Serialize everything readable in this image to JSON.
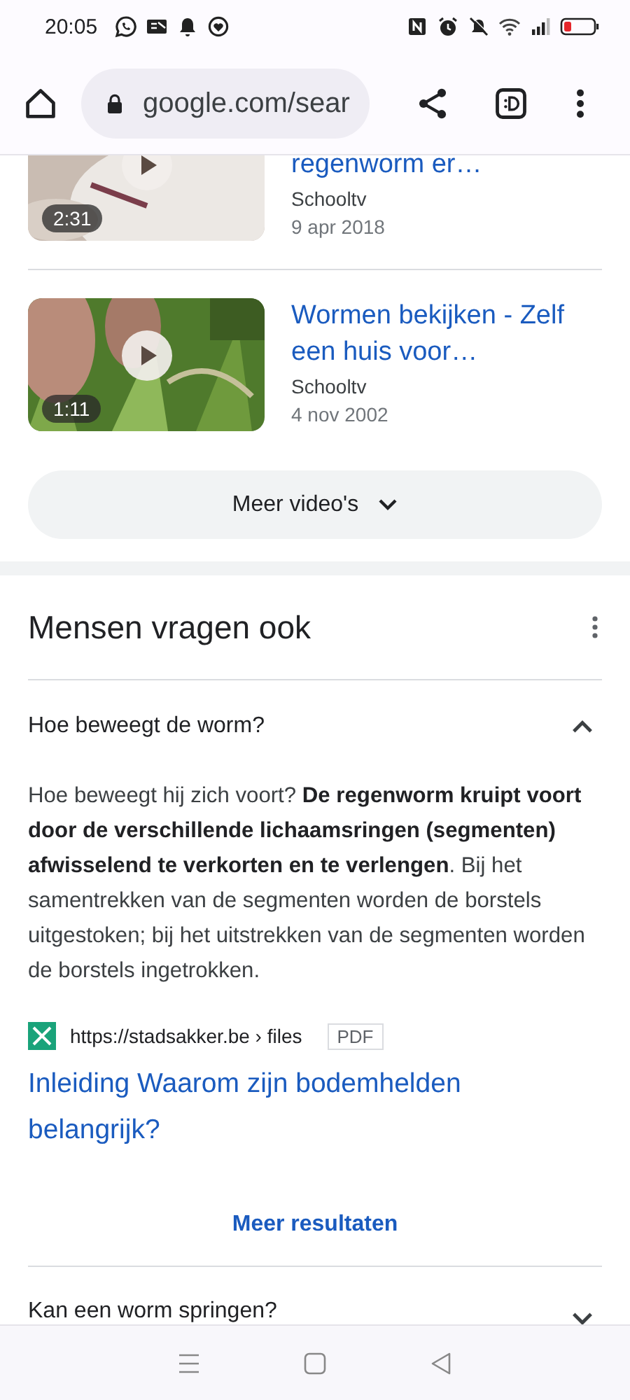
{
  "status_bar": {
    "time": "20:05"
  },
  "toolbar": {
    "url": "google.com/sear"
  },
  "videos": [
    {
      "title": "regenworm er…",
      "source": "Schooltv",
      "date": "9 apr 2018",
      "duration": "2:31"
    },
    {
      "title": "Wormen bekijken - Zelf een huis voor…",
      "source": "Schooltv",
      "date": "4 nov 2002",
      "duration": "1:11"
    }
  ],
  "more_videos": "Meer video's",
  "people_also_ask": {
    "title": "Mensen vragen ook",
    "questions": [
      {
        "question": "Hoe beweegt de worm?",
        "expanded": true,
        "answer": "Hoe beweegt hij zich voort? **De regenworm kruipt voort door de verschillende lichaamsringen (segmenten) afwisselend te verkorten en te verlengen**. Bij het samentrekken van de segmenten worden de borstels uitgestoken; bij het uitstrekken van de segmenten worden de borstels ingetrokken.",
        "source_url": "https://stadsakker.be › files",
        "file_type": "PDF",
        "link": "Inleiding Waarom zijn bodemhelden belangrijk?",
        "more": "Meer resultaten"
      },
      {
        "question": "Kan een worm springen?",
        "expanded": false
      }
    ]
  }
}
